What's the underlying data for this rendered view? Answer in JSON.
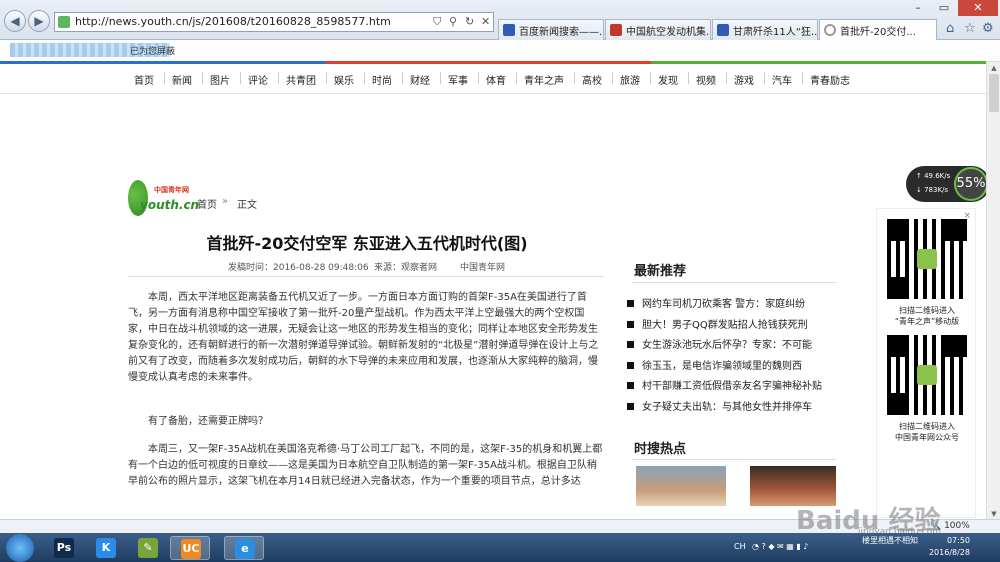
{
  "browser": {
    "url": "http://news.youth.cn/js/201608/t20160828_8598577.htm",
    "tabs": [
      {
        "label": "百度新闻搜索——...",
        "color": "#2f5bb7"
      },
      {
        "label": "中国航空发动机集...",
        "color": "#c0392b"
      },
      {
        "label": "甘肃歼杀11人“狂...",
        "color": "#2f5bb7"
      },
      {
        "label": "首批歼-20交付...",
        "color": "#999999"
      }
    ],
    "back_icon": "back-arrow-icon",
    "forward_icon": "forward-arrow-icon",
    "favbar_text": "已为您屏蔽"
  },
  "site_nav": [
    "首页",
    "新闻",
    "图片",
    "评论",
    "共青团",
    "娱乐",
    "时尚",
    "财经",
    "军事",
    "体育",
    "青年之声",
    "高校",
    "旅游",
    "发现",
    "视频",
    "游戏",
    "汽车",
    "青春励志"
  ],
  "logo": {
    "cn": "中国青年网",
    "en": "youth.cn"
  },
  "breadcrumb": {
    "home": "首页",
    "sep": "»",
    "current": "正文"
  },
  "article": {
    "title": "首批歼-20交付空军 东亚进入五代机时代(图)",
    "published": "发稿时间：2016-08-28 09:48:06",
    "source": "来源：观察者网",
    "site": "中国青年网",
    "paragraphs": [
      "本周，西太平洋地区距离装备五代机又近了一步。一方面日本方面订购的首架F-35A在美国进行了首飞，另一方面有消息称中国空军接收了第一批歼-20量产型战机。作为西太平洋上空最强大的两个空权国家，中日在战斗机领域的这一进展，无疑会让这一地区的形势发生相当的变化；同样让本地区安全形势发生复杂变化的，还有朝鲜进行的新一次潜射弹道导弹试验。朝鲜新发射的“北极星”潜射弹道导弹在设计上与之前又有了改变，而随着多次发射成功后，朝鲜的水下导弹的未来应用和发展，也逐渐从大家纯粹的脑洞，慢慢变成认真考虑的未来事件。",
      "有了备胎，还需要正牌吗？",
      "本周三，又一架F-35A战机在美国洛克希德·马丁公司工厂起飞，不同的是，这架F-35的机身和机翼上都有一个白边的低可视度的日章纹——这是美国为日本航空自卫队制造的第一架F-35A战斗机。根据自卫队稍早前公布的照片显示，这架飞机在本月14日就已经进入完备状态，作为一个重要的项目节点，总计多达"
    ]
  },
  "sidebar": {
    "recommend_title": "最新推荐",
    "recommend": [
      "网约车司机刀砍乘客 警方：家庭纠纷",
      "胆大！男子QQ群发贴招人抢钱获死刑",
      "女生游泳池玩水后怀孕？专家：不可能",
      "徐玉玉，是电信诈骗领域里的魏则西",
      "村干部赚工资低假借亲友名字骗神秘补贴",
      "女子疑丈夫出轨：与其他女性并排停车"
    ],
    "hot_title": "时搜热点"
  },
  "qr": {
    "close": "×",
    "caption1": [
      "扫描二维码进入",
      "“青年之声”移动版"
    ],
    "caption2": [
      "扫描二维码进入",
      "中国青年网公众号"
    ]
  },
  "speed_widget": {
    "up": "49.6K/s",
    "down": "783K/s",
    "percent": "55%"
  },
  "statusbar": {
    "zoom": "100%"
  },
  "watermark": {
    "text": "Baidu 经验",
    "sub": "jingyan.baidu.com"
  },
  "taskbar": {
    "apps": [
      {
        "name": "ps-app",
        "glyph": "Ps",
        "color": "#0f2a4a"
      },
      {
        "name": "k-app",
        "glyph": "K",
        "color": "#2a8be8"
      },
      {
        "name": "paint-app",
        "glyph": "✎",
        "color": "#7aa33a"
      },
      {
        "name": "uc-app",
        "glyph": "UC",
        "color": "#f08a24"
      },
      {
        "name": "ie-app",
        "glyph": "e",
        "color": "#2b8fe0"
      }
    ],
    "lang": "CH",
    "tray_text": "楼里相遇不相知",
    "time": "07:50",
    "date": "2016/8/28"
  }
}
